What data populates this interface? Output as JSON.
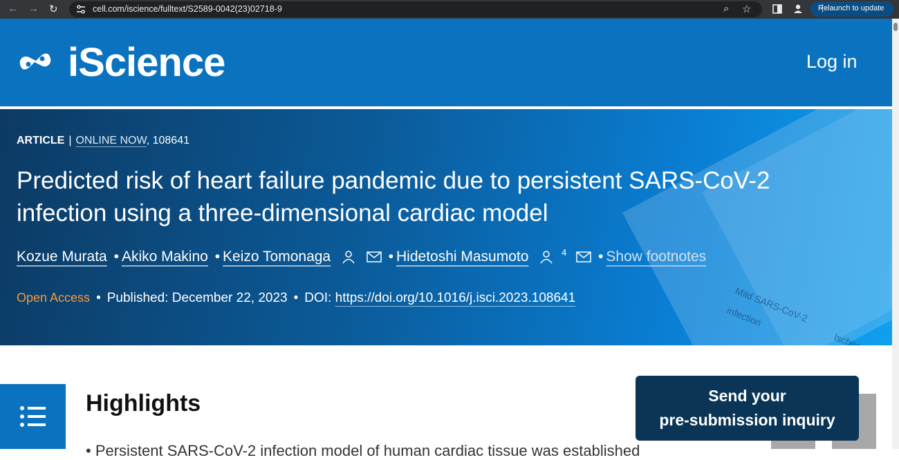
{
  "browser": {
    "url": "cell.com/iscience/fulltext/S2589-0042(23)02718-9",
    "relaunch_label": "Relaunch to update"
  },
  "header": {
    "logo_text": "iScience",
    "login_label": "Log in"
  },
  "article": {
    "type": "ARTICLE",
    "status": "ONLINE NOW",
    "number": ", 108641",
    "title": "Predicted risk of heart failure pandemic due to persistent SARS-CoV-2 infection using a three-dimensional cardiac model",
    "authors": [
      "Kozue Murata",
      "Akiko Makino",
      "Keizo Tomonaga",
      "Hidetoshi Masumoto"
    ],
    "footnote_sup": "4",
    "show_footnotes": "Show footnotes",
    "open_access": "Open Access",
    "published_label": "Published:",
    "published_date": "December 22, 2023",
    "doi_label": "DOI:",
    "doi": "https://doi.org/10.1016/j.isci.2023.108641"
  },
  "hero_figure": {
    "label1": "Mild SARS-CoV-2",
    "label2": "infection",
    "label3": "Ischemi"
  },
  "content": {
    "highlights_heading": "Highlights",
    "first_line": "• Persistent SARS-CoV-2 infection model of human cardiac tissue was established"
  },
  "cta": {
    "line1": "Send your",
    "line2": "pre-submission inquiry"
  },
  "colors": {
    "brand_blue": "#0b72c0",
    "open_access_orange": "#f39a3a",
    "cta_navy": "#0a3556"
  }
}
